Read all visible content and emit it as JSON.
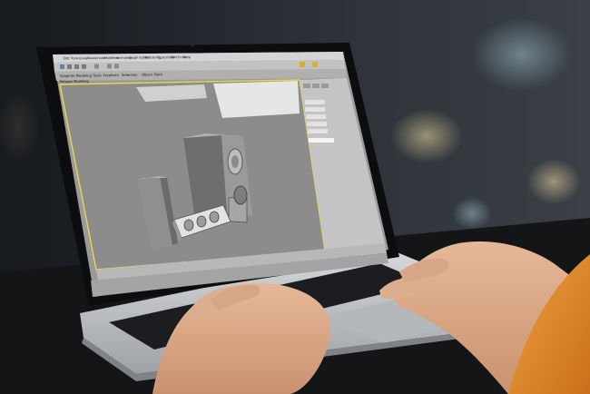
{
  "scene": {
    "subject": "laptop-with-3d-modeling-software",
    "colors": {
      "background_dark": "#1e2226",
      "table": "#141517",
      "laptop_body": "#c9ccd0",
      "bezel": "#0d0d0f",
      "viewport_gray": "#8c8c8c",
      "panel_gray": "#c4c4c4",
      "selection_yellow": "#e8d84a",
      "skin": "#d9a98a",
      "sleeve": "#e08a2a"
    }
  },
  "app": {
    "menu": {
      "items": [
        "Edit",
        "Tools",
        "Group",
        "Views",
        "Create",
        "Modifiers",
        "Animation",
        "Graph Editors",
        "Rendering",
        "Customize",
        "MAXScript",
        "Help"
      ]
    },
    "ribbon": {
      "tabs": [
        "Graphite Modeling Tools",
        "Freeform",
        "Selection",
        "Object Paint"
      ],
      "sub_label": "Polygon Modeling"
    },
    "viewport": {
      "objects": [
        "speaker-tower",
        "center-speaker",
        "side-speaker"
      ]
    }
  }
}
